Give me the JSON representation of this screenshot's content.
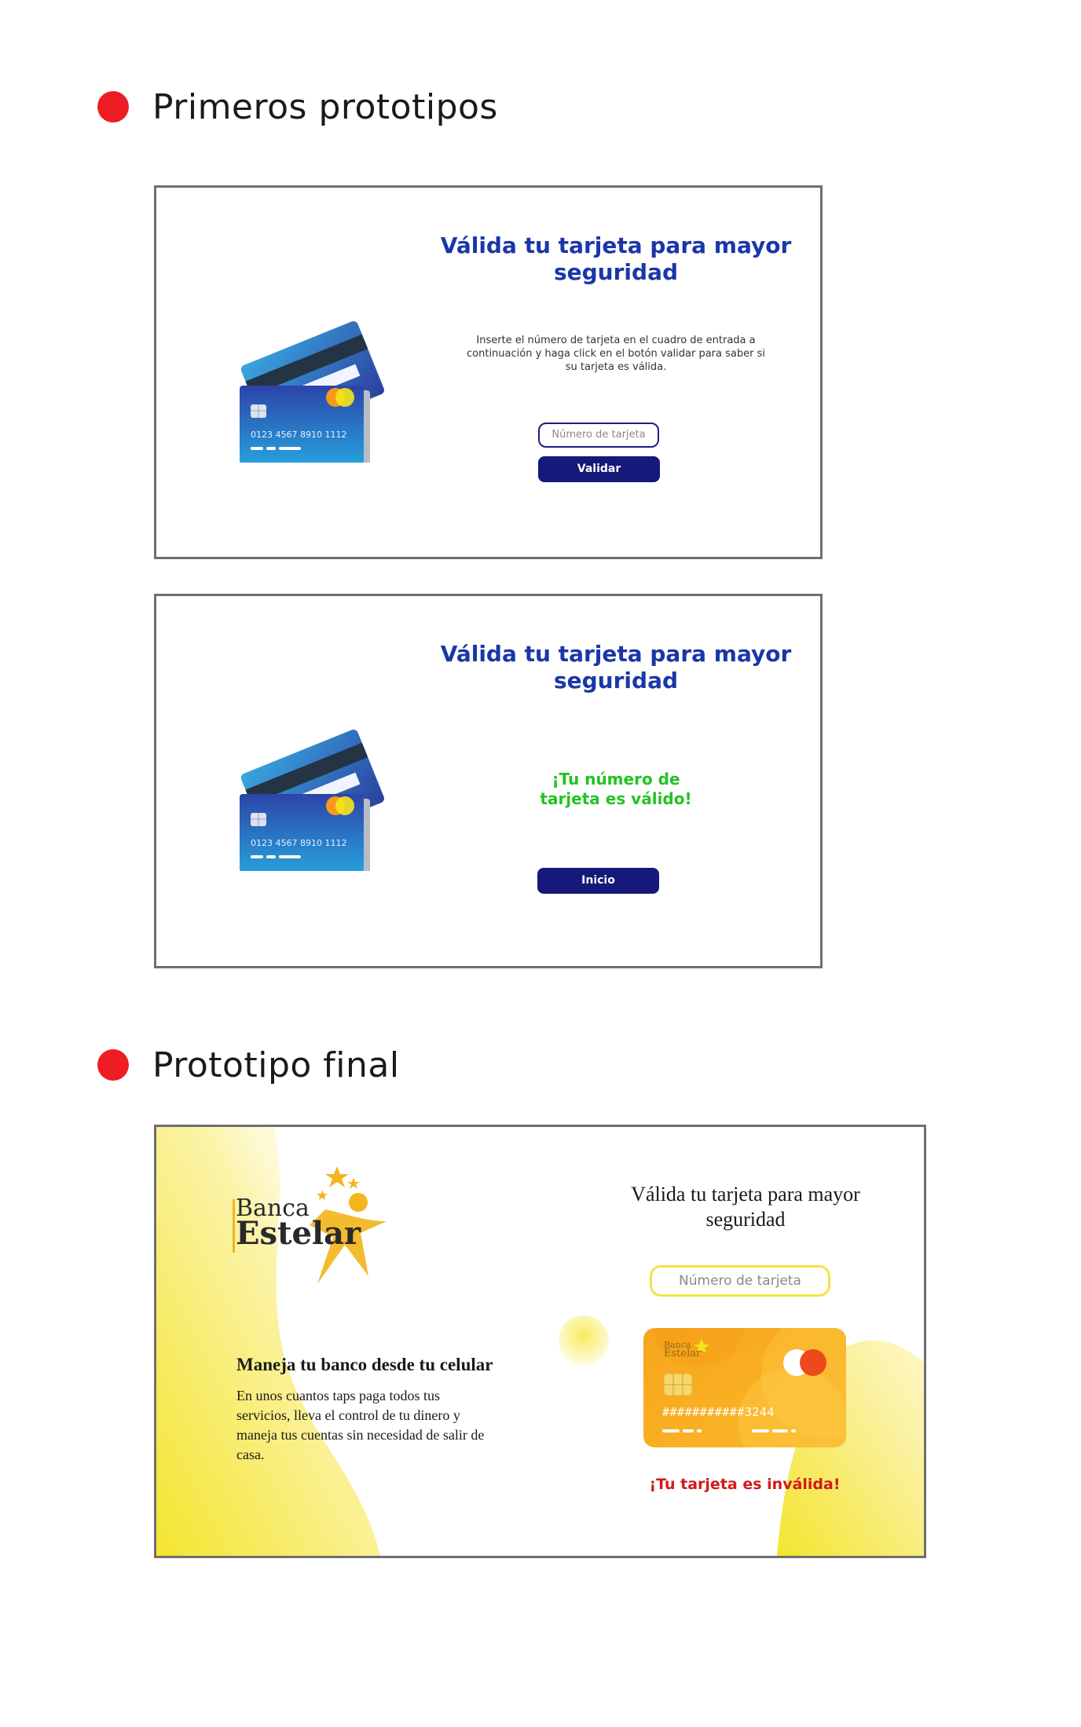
{
  "sections": {
    "early": {
      "title": "Primeros prototipos"
    },
    "final": {
      "title": "Prototipo final"
    }
  },
  "colors": {
    "bullet": "#ee1c23",
    "title_blue": "#1b36a8",
    "button_navy": "#15197a",
    "success_green": "#22c322",
    "error_red": "#d11a1a",
    "brand_yellow": "#f4e34a",
    "card_orange": "#f7a51c"
  },
  "proto1": {
    "title": "Válida tu tarjeta para mayor seguridad",
    "instructions": "Inserte el número de tarjeta en el cuadro de entrada a continuación y haga click en el botón validar para saber si su tarjeta es válida.",
    "input_placeholder": "Número de tarjeta",
    "button_label": "Validar",
    "card_number": "0123  4567  8910  1112"
  },
  "proto2": {
    "title": "Válida tu tarjeta para mayor seguridad",
    "message": "¡Tu número de tarjeta es válido!",
    "button_label": "Inicio",
    "card_number": "0123  4567  8910  1112"
  },
  "final": {
    "brand_line1": "Banca",
    "brand_line2": "Estelar",
    "title": "Válida tu tarjeta para mayor seguridad",
    "input_placeholder": "Número de tarjeta",
    "card_brand_line1": "Banca",
    "card_brand_line2": "Estelar",
    "card_number": "###########3244",
    "message": "¡Tu tarjeta es inválida!",
    "slogan": "Maneja tu banco desde tu celular",
    "slogan_text": "En unos cuantos taps paga todos tus servicios, lleva el control de tu dinero y maneja tus cuentas sin necesidad de salir de casa."
  }
}
